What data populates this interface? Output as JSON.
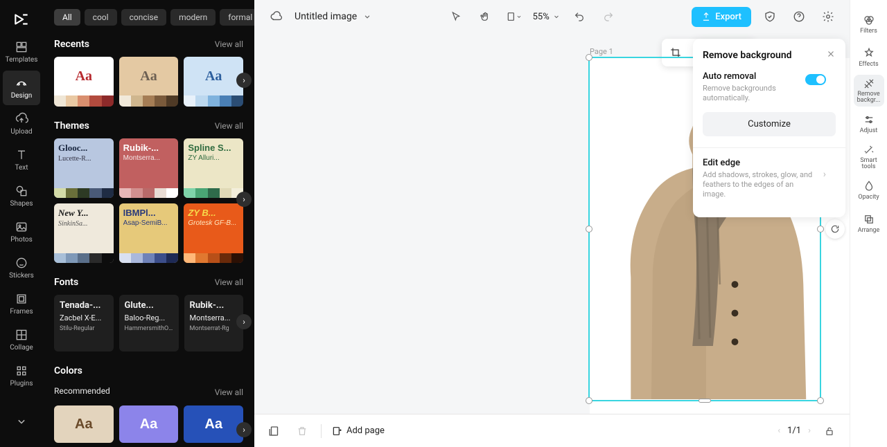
{
  "rail": {
    "items": [
      {
        "label": "Templates"
      },
      {
        "label": "Design"
      },
      {
        "label": "Upload"
      },
      {
        "label": "Text"
      },
      {
        "label": "Shapes"
      },
      {
        "label": "Photos"
      },
      {
        "label": "Stickers"
      },
      {
        "label": "Frames"
      },
      {
        "label": "Collage"
      },
      {
        "label": "Plugins"
      }
    ]
  },
  "filters": {
    "chips": [
      "All",
      "cool",
      "concise",
      "modern",
      "formal"
    ]
  },
  "sections": {
    "recents": {
      "title": "Recents",
      "view_all": "View all"
    },
    "themes": {
      "title": "Themes",
      "view_all": "View all"
    },
    "fonts": {
      "title": "Fonts",
      "view_all": "View all"
    },
    "colors": {
      "title": "Colors",
      "subtitle": "Recommended",
      "view_all": "View all"
    }
  },
  "recents": [
    {
      "aa": "Aa",
      "bg": "#ffffff",
      "fg": "#b72a2f",
      "strip": [
        "#efe6d6",
        "#e9c9a4",
        "#d98f6f",
        "#b24b3e",
        "#8d2a2a"
      ]
    },
    {
      "aa": "Aa",
      "bg": "#e4c9a3",
      "fg": "#6d6053",
      "strip": [
        "#f1e9da",
        "#cfb68e",
        "#a57d55",
        "#7a5a3b",
        "#4f3a26"
      ]
    },
    {
      "aa": "Aa",
      "bg": "#cfe3f5",
      "fg": "#2d5f9e",
      "strip": [
        "#e8f1fa",
        "#bcd8ef",
        "#7fb2dd",
        "#4a7fb5",
        "#2b4d74"
      ]
    }
  ],
  "themes": [
    {
      "name": "Glooc...",
      "sub": "Lucette-R...",
      "bg": "#b8c7e0",
      "fg": "#1a2740",
      "subcolor": "#334",
      "strip": [
        "#d4dba8",
        "#6a6f3a",
        "#2d3a24",
        "#4a5a78",
        "#1f2c44"
      ],
      "font": "Georgia, serif"
    },
    {
      "name": "Rubik-...",
      "sub": "Montserra...",
      "bg": "#c16060",
      "fg": "#ffffff",
      "subcolor": "#f4e6e6",
      "strip": [
        "#e7b7b7",
        "#d2908f",
        "#b96a69",
        "#e8dcd4",
        "#ffffff"
      ],
      "font": "sans-serif"
    },
    {
      "name": "Spline S...",
      "sub": "ZY Alluri...",
      "bg": "#ece6c6",
      "fg": "#2f6b3f",
      "subcolor": "#2f6b3f",
      "strip": [
        "#7fd3a9",
        "#4aa574",
        "#2f6b4b",
        "#e0d9b6",
        "#f3efdb"
      ],
      "font": "sans-serif"
    },
    {
      "name": "New Y...",
      "sub": "SinkinSa...",
      "bg": "#efe9dc",
      "fg": "#1a1a1a",
      "subcolor": "#555",
      "strip": [
        "#a8bfd8",
        "#7f99b8",
        "#5a6f8a",
        "#2a2a2a",
        "#0d0d0d"
      ],
      "font": "Georgia, serif",
      "italic": true
    },
    {
      "name": "IBMPl...",
      "sub": "Asap-SemiB...",
      "bg": "#e6c97a",
      "fg": "#2a3a7a",
      "subcolor": "#2a3a7a",
      "strip": [
        "#d9e0f0",
        "#aab8dc",
        "#6f82b8",
        "#3c4e8a",
        "#1e2a55"
      ],
      "font": "sans-serif"
    },
    {
      "name": "ZY B...",
      "sub": "Grotesk GF-B...",
      "bg": "#e85a1a",
      "fg": "#f7d94a",
      "subcolor": "#ffe8c0",
      "strip": [
        "#ffb878",
        "#e07830",
        "#b84f18",
        "#6a2a0a",
        "#2c1004"
      ],
      "font": "sans-serif",
      "italic": true
    }
  ],
  "fonts": [
    {
      "l1": "Tenada-...",
      "l2": "Zacbel X-E...",
      "l3": "Stilu-Regular"
    },
    {
      "l1": "Glute...",
      "l2": "Baloo-Reg...",
      "l3": "HammersmithOn..."
    },
    {
      "l1": "Rubik-...",
      "l2": "Montserra...",
      "l3": "Montserrat-Rg"
    }
  ],
  "colors": [
    {
      "aa": "Aa",
      "bg": "#e3d4bd",
      "fg": "#6a4a2a"
    },
    {
      "aa": "Aa",
      "bg": "#8c84ea",
      "fg": "#ffffff"
    },
    {
      "aa": "Aa",
      "bg": "#2651b8",
      "fg": "#ffffff"
    }
  ],
  "header": {
    "title": "Untitled image",
    "zoom": "55%",
    "export": "Export"
  },
  "canvas": {
    "page_label": "Page 1"
  },
  "remove_bg": {
    "title": "Remove background",
    "auto_label": "Auto removal",
    "auto_desc": "Remove backgrounds automatically.",
    "auto_on": true,
    "customize": "Customize",
    "edit_edge_label": "Edit edge",
    "edit_edge_desc": "Add shadows, strokes, glow, and feathers to the edges of an image."
  },
  "prop_rail": {
    "items": [
      {
        "label": "Filters"
      },
      {
        "label": "Effects"
      },
      {
        "label": "Remove backgr..."
      },
      {
        "label": "Adjust"
      },
      {
        "label": "Smart tools"
      },
      {
        "label": "Opacity"
      },
      {
        "label": "Arrange"
      }
    ]
  },
  "bottombar": {
    "add_page": "Add page",
    "pager": "1/1"
  }
}
